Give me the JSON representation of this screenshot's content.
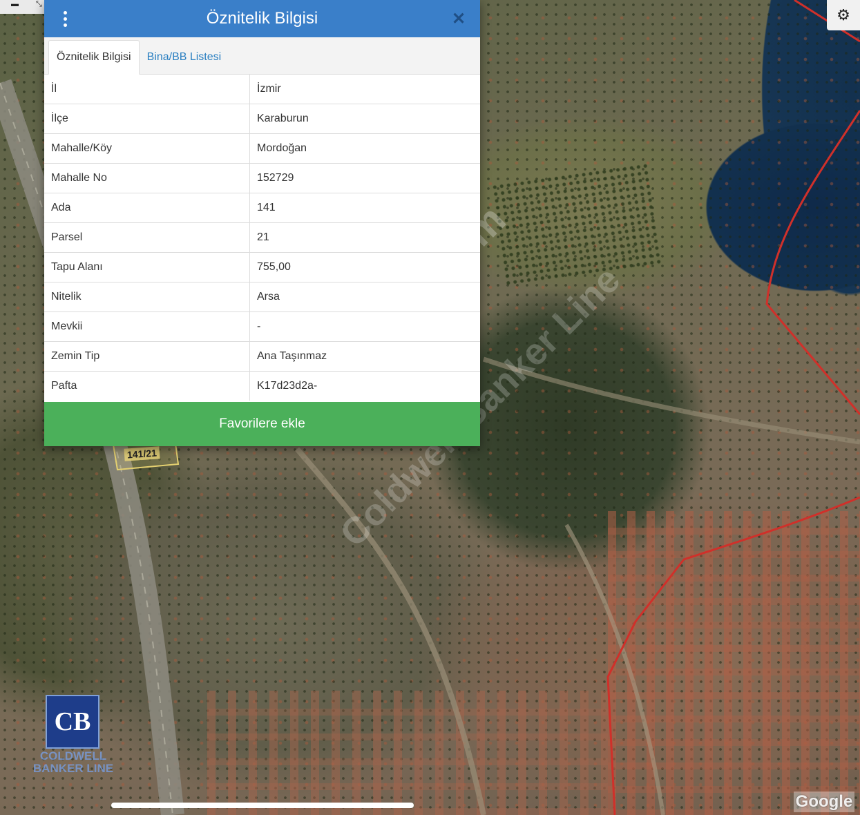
{
  "dialog": {
    "title": "Öznitelik Bilgisi",
    "tabs": [
      {
        "label": "Öznitelik Bilgisi",
        "active": true
      },
      {
        "label": "Bina/BB Listesi",
        "active": false
      }
    ],
    "rows": [
      {
        "key": "İl",
        "value": "İzmir"
      },
      {
        "key": "İlçe",
        "value": "Karaburun"
      },
      {
        "key": "Mahalle/Köy",
        "value": "Mordoğan"
      },
      {
        "key": "Mahalle No",
        "value": "152729"
      },
      {
        "key": "Ada",
        "value": "141"
      },
      {
        "key": "Parsel",
        "value": "21"
      },
      {
        "key": "Tapu Alanı",
        "value": "755,00"
      },
      {
        "key": "Nitelik",
        "value": "Arsa"
      },
      {
        "key": "Mevkii",
        "value": "-"
      },
      {
        "key": "Zemin Tip",
        "value": "Ana Taşınmaz"
      },
      {
        "key": "Pafta",
        "value": "K17d23d2a-"
      }
    ],
    "favorite_button": "Favorilere ekle",
    "menu_icon": "vertical-ellipsis-icon",
    "close_icon": "close-icon"
  },
  "map": {
    "parcel_label": "141/21",
    "watermark": "emlakjet.com",
    "watermark2": "Coldwell Banker Line",
    "logo_text": "CB",
    "logo_caption": "COLDWELL BANKER LINE",
    "attribution": "Google",
    "settings_icon": "gear-icon",
    "boundary_color": "#d0302a"
  },
  "colors": {
    "header": "#3a7fc9",
    "tab_link": "#2a7fc1",
    "favorite": "#4bb05a"
  }
}
